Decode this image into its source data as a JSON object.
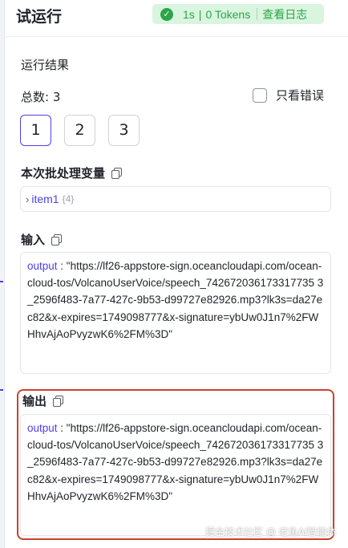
{
  "header": {
    "title": "试运行",
    "status": {
      "duration": "1s",
      "separator": "|",
      "tokens": "0 Tokens",
      "view_log": "查看日志",
      "color": "#2ba548"
    }
  },
  "result": {
    "section_title": "运行结果",
    "total_label": "总数: 3",
    "only_errors_label": "只看错误",
    "only_errors_checked": false,
    "pages": [
      "1",
      "2",
      "3"
    ],
    "active_page": "1"
  },
  "batch": {
    "title": "本次批处理变量",
    "item_key": "item1",
    "item_count": "{4}"
  },
  "input": {
    "title": "输入",
    "key": "output",
    "value": " : \"https://lf26-appstore-sign.oceancloudapi.com/ocean-cloud-tos/VolcanoUserVoice/speech_742672036173317735 3_2596f483-7a77-427c-9b53-d99727e82926.mp3?lk3s=da27ec82&x-expires=1749098777&x-signature=ybUw0J1n7%2FWHhvAjAoPvyzwK6%2FM%3D\""
  },
  "output": {
    "title": "输出",
    "key": "output",
    "value": " : \"https://lf26-appstore-sign.oceancloudapi.com/ocean-cloud-tos/VolcanoUserVoice/speech_742672036173317735 3_2596f483-7a77-427c-9b53-d99727e82926.mp3?lk3s=da27ec82&x-expires=1749098777&x-signature=ybUw0J1n7%2FWHhvAjAoPvyzwK6%2FM%3D\""
  },
  "watermark": "掘金技术社区 @ 老鱼AI智能体",
  "colors": {
    "accent": "#4e40e5",
    "highlight_border": "#c9432b"
  }
}
